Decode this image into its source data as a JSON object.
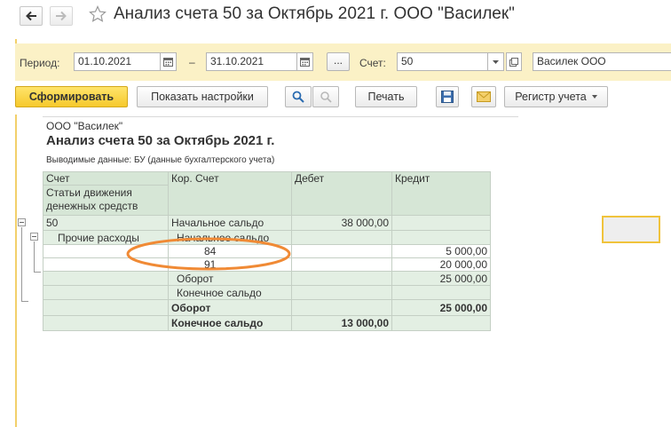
{
  "window": {
    "title": "Анализ счета 50 за Октябрь 2021 г. ООО \"Василек\""
  },
  "params": {
    "period_label": "Период:",
    "date_from": "01.10.2021",
    "date_dash": "–",
    "date_to": "31.10.2021",
    "dots_label": "...",
    "account_label": "Счет:",
    "account_value": "50",
    "organization_value": "Василек ООО"
  },
  "toolbar": {
    "generate_label": "Сформировать",
    "settings_label": "Показать настройки",
    "print_label": "Печать",
    "register_label": "Регистр учета"
  },
  "report": {
    "organization": "ООО \"Василек\"",
    "title": "Анализ счета 50 за Октябрь 2021 г.",
    "output_data": "Выводимые данные:  БУ (данные бухгалтерского учета)",
    "headers": {
      "account": "Счет",
      "cash_flow_items": "Статьи движения денежных средств",
      "corr_account": "Кор. Счет",
      "debit": "Дебет",
      "credit": "Кредит"
    },
    "rows": [
      {
        "col1": "50",
        "col2": "Начальное сальдо",
        "debit": "38 000,00",
        "credit": ""
      },
      {
        "col1": "Прочие расходы",
        "col2": "Начальное сальдо",
        "debit": "",
        "credit": ""
      },
      {
        "col1": "",
        "col2": "84",
        "debit": "",
        "credit": "5 000,00"
      },
      {
        "col1": "",
        "col2": "91",
        "debit": "",
        "credit": "20 000,00"
      },
      {
        "col1": "",
        "col2": "Оборот",
        "debit": "",
        "credit": "25 000,00"
      },
      {
        "col1": "",
        "col2": "Конечное сальдо",
        "debit": "",
        "credit": ""
      },
      {
        "col1": "",
        "col2": "Оборот",
        "debit": "",
        "credit": "25 000,00"
      },
      {
        "col1": "",
        "col2": "Конечное сальдо",
        "debit": "13 000,00",
        "credit": ""
      }
    ]
  },
  "colors": {
    "accent_yellow": "#f6c92c",
    "params_bg": "#fbf1c6",
    "table_header": "#d6e6d6",
    "annotation_orange": "#f08a35"
  }
}
